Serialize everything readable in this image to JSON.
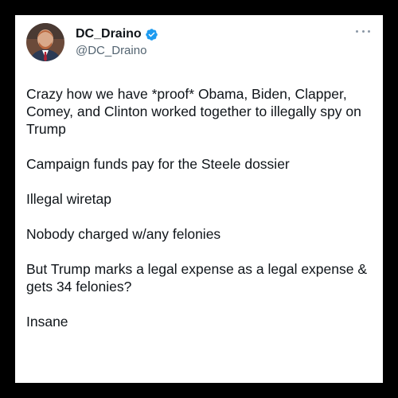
{
  "post": {
    "author": {
      "display_name": "DC_Draino",
      "handle": "@DC_Draino",
      "verified": true,
      "avatar_icon": "profile-photo",
      "verified_icon": "verified-badge-icon",
      "accent_color": "#1d9bf0"
    },
    "more_icon": "more-options-icon",
    "paragraphs": [
      "Crazy how we have *proof* Obama, Biden, Clapper, Comey, and Clinton worked together to illegally spy on Trump",
      "Campaign funds pay for the Steele dossier",
      "Illegal wiretap",
      "Nobody charged w/any felonies",
      "But Trump marks a legal expense as a legal expense & gets 34 felonies?",
      "Insane"
    ]
  }
}
